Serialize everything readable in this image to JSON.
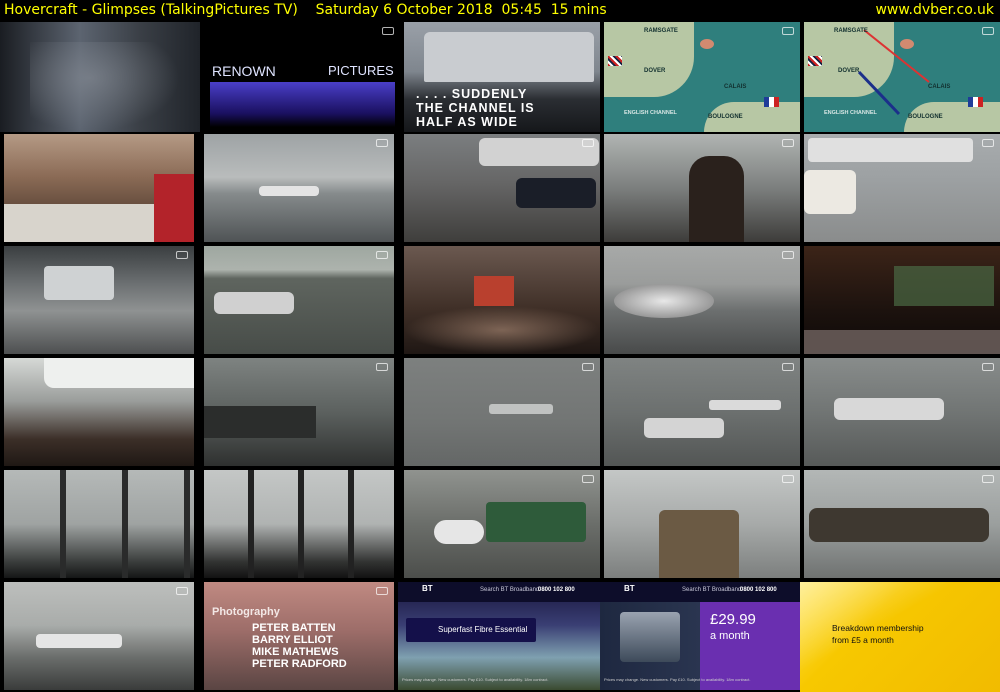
{
  "header": {
    "title": "Hovercraft - Glimpses (TalkingPictures TV)    Saturday 6 October 2018  05:45  15 mins",
    "site": "www.dvber.co.uk"
  },
  "colors": {
    "header_text": "#ffff00",
    "background": "#000000",
    "ad_purple": "#6a2fb0",
    "ad_yellow": "#f5c400"
  },
  "thumbnails": {
    "r1c2": {
      "left": "RENOWN",
      "right": "PICTURES"
    },
    "r1c3": {
      "caption": ". . . . SUDDENLY\nTHE CHANNEL IS\nHALF AS WIDE"
    },
    "map": {
      "ramsgate": "RAMSGATE",
      "dover": "DOVER",
      "calais": "CALAIS",
      "boulogne": "BOULOGNE",
      "channel": "ENGLISH CHANNEL"
    },
    "r6c2": {
      "heading": "Photography",
      "names": [
        "PETER BATTEN",
        "BARRY ELLIOT",
        "MIKE MATHEWS",
        "PETER RADFORD"
      ]
    },
    "ad": {
      "bt": "BT",
      "search": "Search BT Broadband",
      "phone": "0800 102 800",
      "product": "Superfast Fibre Essential",
      "price": "£29.99",
      "per": "a month",
      "fine": "Prices may change. New customers. Pay £10. Subject to availability. 18m contract."
    },
    "promo": {
      "line1": "Breakdown membership",
      "line2": "from £5 a month"
    }
  }
}
